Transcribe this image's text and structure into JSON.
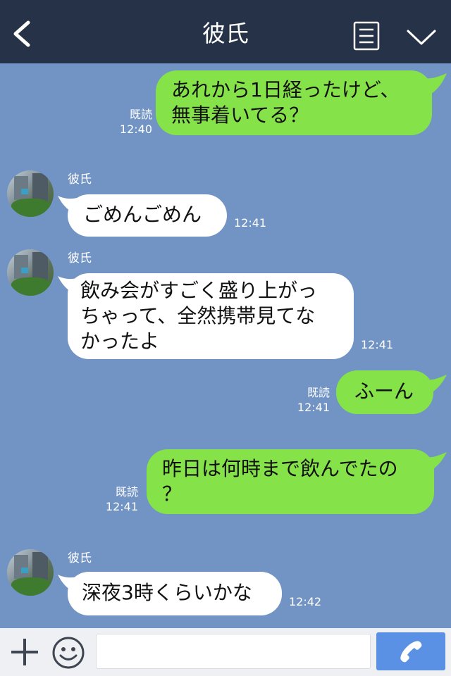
{
  "header": {
    "title": "彼氏"
  },
  "messages": [
    {
      "side": "me",
      "text": "あれから1日経ったけど、\n無事着いてる？",
      "read": "既読",
      "time": "12:40"
    },
    {
      "side": "them",
      "sender": "彼氏",
      "text": "ごめんごめん",
      "time": "12:41"
    },
    {
      "side": "them",
      "sender": "彼氏",
      "text": "飲み会がすごく盛り上がっ\nちゃって、全然携帯見てな\nかったよ",
      "time": "12:41"
    },
    {
      "side": "me",
      "text": "ふーん",
      "read": "既読",
      "time": "12:41"
    },
    {
      "side": "me",
      "text": "昨日は何時まで飲んでたの\n？",
      "read": "既読",
      "time": "12:41"
    },
    {
      "side": "them",
      "sender": "彼氏",
      "text": "深夜3時くらいかな",
      "time": "12:42"
    }
  ],
  "input": {
    "placeholder": ""
  },
  "colors": {
    "header_bg": "#263247",
    "chat_bg": "#7294c4",
    "my_bubble": "#85e249",
    "their_bubble": "#ffffff",
    "call_button": "#5b91e4"
  }
}
